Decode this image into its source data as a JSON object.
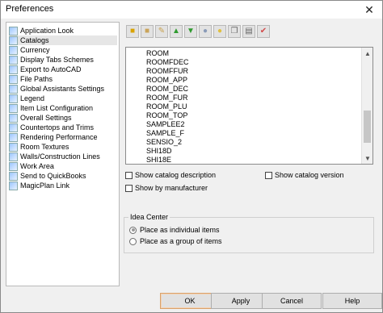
{
  "window": {
    "title": "Preferences",
    "close_icon": "close-icon"
  },
  "sidebar": {
    "items": [
      {
        "label": "Application Look",
        "icon": "application-look-icon"
      },
      {
        "label": "Catalogs",
        "icon": "catalogs-icon",
        "selected": true
      },
      {
        "label": "Currency",
        "icon": "currency-icon"
      },
      {
        "label": "Display Tabs Schemes",
        "icon": "display-tabs-icon"
      },
      {
        "label": "Export to AutoCAD",
        "icon": "export-autocad-icon"
      },
      {
        "label": "File Paths",
        "icon": "file-paths-icon"
      },
      {
        "label": "Global Assistants Settings",
        "icon": "global-assistants-icon"
      },
      {
        "label": "Legend",
        "icon": "legend-icon"
      },
      {
        "label": "Item List Configuration",
        "icon": "item-list-icon"
      },
      {
        "label": "Overall Settings",
        "icon": "overall-settings-icon"
      },
      {
        "label": "Countertops and Trims",
        "icon": "countertops-icon"
      },
      {
        "label": "Rendering Performance",
        "icon": "rendering-icon"
      },
      {
        "label": "Room Textures",
        "icon": "room-textures-icon"
      },
      {
        "label": "Walls/Construction Lines",
        "icon": "walls-icon"
      },
      {
        "label": "Work Area",
        "icon": "work-area-icon"
      },
      {
        "label": "Send to QuickBooks",
        "icon": "quickbooks-icon"
      },
      {
        "label": "MagicPlan Link",
        "icon": "magicplan-icon"
      }
    ]
  },
  "toolbar": {
    "buttons": [
      {
        "icon": "open-folder-icon"
      },
      {
        "icon": "folder-icon"
      },
      {
        "icon": "edit-folder-icon"
      },
      {
        "icon": "arrow-up-icon"
      },
      {
        "icon": "arrow-down-icon"
      },
      {
        "icon": "lightbulb-icon"
      },
      {
        "icon": "lightbulb-alt-icon"
      },
      {
        "icon": "copy-icon"
      },
      {
        "icon": "properties-icon"
      },
      {
        "icon": "checkmark-icon"
      }
    ]
  },
  "catalog_list": {
    "items": [
      "ROOM",
      "ROOMFDEC",
      "ROOMFFUR",
      "ROOM_APP",
      "ROOM_DEC",
      "ROOM_FUR",
      "ROOM_PLU",
      "ROOM_TOP",
      "SAMPLEE2",
      "SAMPLE_F",
      "SENSIO_2",
      "SHI18D",
      "SHI18E"
    ]
  },
  "options": {
    "show_catalog_description": "Show catalog description",
    "show_catalog_version": "Show catalog version",
    "show_by_manufacturer": "Show by manufacturer"
  },
  "idea_center": {
    "title": "Idea Center",
    "option_individual": "Place as individual items",
    "option_group": "Place as a group of items",
    "selected": "individual"
  },
  "buttons": {
    "ok": "OK",
    "apply": "Apply",
    "cancel": "Cancel",
    "help": "Help"
  }
}
